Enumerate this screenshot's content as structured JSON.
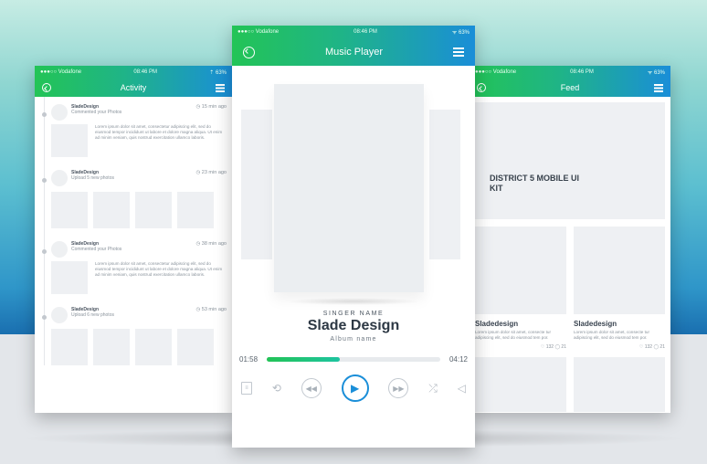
{
  "activity": {
    "status": {
      "carrier": "●●●○○ Vodafone",
      "time": "08:46 PM",
      "battery": "⇡ 63%"
    },
    "title": "Activity",
    "items": [
      {
        "user": "SladeDesign",
        "action": "Commented your Photos",
        "time": "◷ 15 min ago",
        "text": "Lorem ipsum dolor sit amet, consectetur adipiscing elit, sed do eiusmod tempor incididunt ut labore et dolore magna aliqua. Ut enim ad minim veniam, quis nostrud exercitation ullamco laboris."
      },
      {
        "user": "SladeDesign",
        "action": "Upload 5 new photos",
        "time": "◷ 23 min ago"
      },
      {
        "user": "SladeDesign",
        "action": "Commented your Photos",
        "time": "◷ 38 min ago",
        "text": "Lorem ipsum dolor sit amet, consectetur adipiscing elit, sed do eiusmod tempor incididunt ut labore et dolore magna aliqua. Ut enim ad minim veniam, quis nostrud exercitation ullamco laboris."
      },
      {
        "user": "SladeDesign",
        "action": "Upload 6 new photos",
        "time": "◷ 53 min ago"
      }
    ]
  },
  "player": {
    "status": {
      "carrier": "●●●○○ Vodafone",
      "time": "08:46 PM",
      "battery": "ᯤ 63%"
    },
    "title": "Music Player",
    "singer_label": "SINGER NAME",
    "singer_name": "Slade Design",
    "album": "Album name",
    "elapsed": "01:58",
    "total": "04:12",
    "progress_fraction": 0.42,
    "controls": [
      "list-icon",
      "repeat-icon",
      "rewind-icon",
      "play-icon",
      "fast-forward-icon",
      "shuffle-icon",
      "volume-icon"
    ]
  },
  "feed": {
    "status": {
      "carrier": "●●●○○ Vodafone",
      "time": "08:46 PM",
      "battery": "ᯤ 63%"
    },
    "title": "Feed",
    "hero_title": "DISTRICT 5 MOBILE UI KIT",
    "cards": [
      {
        "name": "Sladedesign",
        "text": "Lorem ipsum dolor sit amet, consecte tur adipiscing elit, sed do eiusmod tem por.",
        "stats": "♡ 132  ◯ 21"
      },
      {
        "name": "Sladedesign",
        "text": "Lorem ipsum dolor sit amet, consecte tur adipiscing elit, sed do eiusmod tem por.",
        "stats": "♡ 132  ◯ 21"
      }
    ]
  },
  "colors": {
    "accent_green": "#22c356",
    "accent_blue": "#1a8ed8"
  }
}
